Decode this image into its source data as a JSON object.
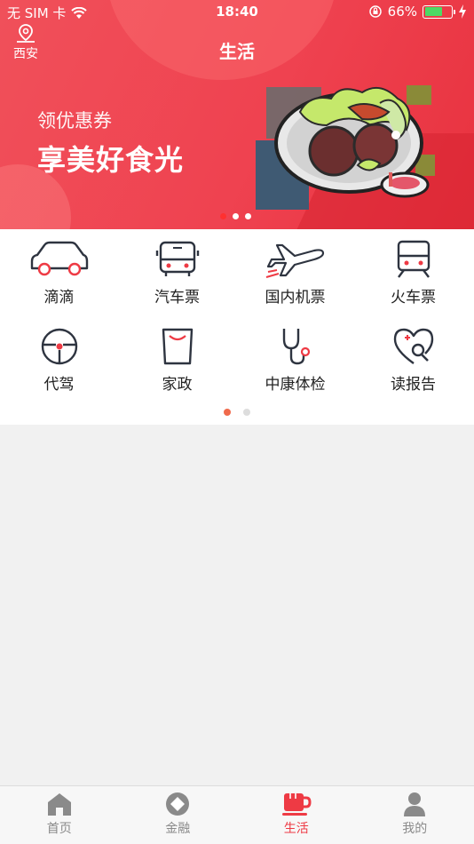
{
  "status_bar": {
    "carrier": "无 SIM 卡",
    "time": "18:40",
    "battery": "66%",
    "battery_level": 0.66
  },
  "header": {
    "location": "西安",
    "title": "生活"
  },
  "banner": {
    "subtitle": "领优惠券",
    "headline": "享美好食光",
    "slide_count": 3,
    "active_slide": 0
  },
  "services": {
    "items": [
      {
        "label": "滴滴",
        "icon": "car-icon"
      },
      {
        "label": "汽车票",
        "icon": "bus-icon"
      },
      {
        "label": "国内机票",
        "icon": "plane-icon"
      },
      {
        "label": "火车票",
        "icon": "train-icon"
      },
      {
        "label": "代驾",
        "icon": "steering-wheel-icon"
      },
      {
        "label": "家政",
        "icon": "cup-icon"
      },
      {
        "label": "中康体检",
        "icon": "stethoscope-icon"
      },
      {
        "label": "读报告",
        "icon": "heart-search-icon"
      }
    ],
    "page_count": 2,
    "active_page": 0
  },
  "tabbar": {
    "items": [
      {
        "label": "首页",
        "icon": "home-icon",
        "active": false
      },
      {
        "label": "金融",
        "icon": "finance-icon",
        "active": false
      },
      {
        "label": "生活",
        "icon": "coffee-icon",
        "active": true
      },
      {
        "label": "我的",
        "icon": "user-icon",
        "active": false
      }
    ]
  },
  "colors": {
    "brand_red": "#ee3a44",
    "accent_orange": "#f06a4c",
    "icon_dark": "#2e3440"
  }
}
